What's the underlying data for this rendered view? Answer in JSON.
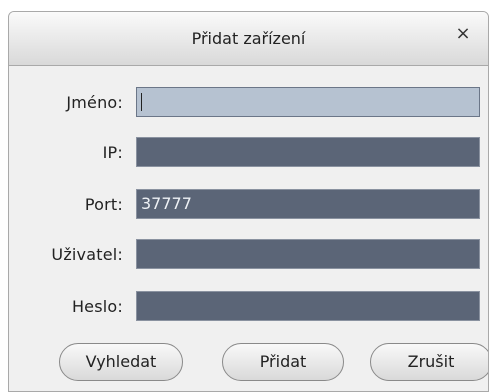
{
  "dialog": {
    "title": "Přidat zařízení",
    "close_symbol": "×"
  },
  "form": {
    "name_label": "Jméno:",
    "name_value": "",
    "ip_label": "IP:",
    "ip_value": "",
    "port_label": "Port:",
    "port_value": "37777",
    "user_label": "Uživatel:",
    "user_value": "",
    "password_label": "Heslo:",
    "password_value": ""
  },
  "buttons": {
    "search": "Vyhledat",
    "add": "Přidat",
    "cancel": "Zrušit"
  }
}
